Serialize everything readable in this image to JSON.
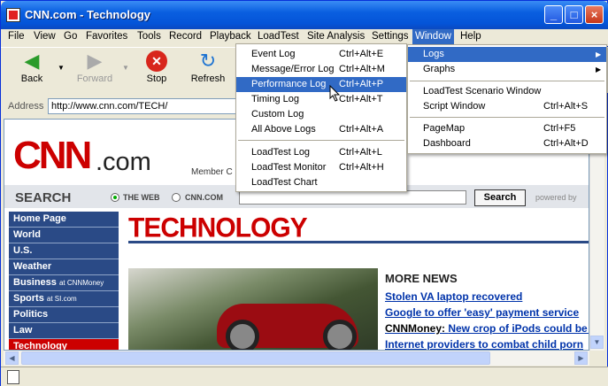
{
  "window": {
    "title": "CNN.com - Technology"
  },
  "menubar": [
    "File",
    "View",
    "Go",
    "Favorites",
    "Tools",
    "Record",
    "Playback",
    "LoadTest",
    "Site Analysis",
    "Settings",
    "Window",
    "Help"
  ],
  "toolbar": {
    "back": "Back",
    "forward": "Forward",
    "stop": "Stop",
    "refresh": "Refresh"
  },
  "address": {
    "label": "Address",
    "value": "http://www.cnn.com/TECH/"
  },
  "page": {
    "logo": "CNN",
    "logo_suffix": ".com",
    "member": "Member C",
    "search_label": "SEARCH",
    "radio_web": "THE WEB",
    "radio_cnn": "CNN.COM",
    "search_button": "Search",
    "powered_by": "powered by",
    "section_title": "TECHNOLOGY",
    "nav": [
      {
        "label": "Home Page",
        "sub": ""
      },
      {
        "label": "World",
        "sub": ""
      },
      {
        "label": "U.S.",
        "sub": ""
      },
      {
        "label": "Weather",
        "sub": ""
      },
      {
        "label": "Business",
        "sub": "at CNNMoney"
      },
      {
        "label": "Sports",
        "sub": "at SI.com"
      },
      {
        "label": "Politics",
        "sub": ""
      },
      {
        "label": "Law",
        "sub": ""
      },
      {
        "label": "Technology",
        "sub": ""
      }
    ],
    "more_news_title": "MORE NEWS",
    "news": [
      {
        "prefix": "",
        "text": "Stolen VA laptop recovered"
      },
      {
        "prefix": "",
        "text": "Google to offer 'easy' payment service"
      },
      {
        "prefix": "CNNMoney: ",
        "text": "New crop of iPods could be d"
      },
      {
        "prefix": "",
        "text": "Internet providers to combat child porn"
      }
    ]
  },
  "logs_menu": [
    {
      "label": "Event Log",
      "shortcut": "Ctrl+Alt+E"
    },
    {
      "label": "Message/Error Log",
      "shortcut": "Ctrl+Alt+M"
    },
    {
      "label": "Performance Log",
      "shortcut": "Ctrl+Alt+P"
    },
    {
      "label": "Timing Log",
      "shortcut": "Ctrl+Alt+T"
    },
    {
      "label": "Custom Log",
      "shortcut": ""
    },
    {
      "label": "All Above Logs",
      "shortcut": "Ctrl+Alt+A"
    },
    {
      "label": "LoadTest Log",
      "shortcut": "Ctrl+Alt+L"
    },
    {
      "label": "LoadTest Monitor",
      "shortcut": "Ctrl+Alt+H"
    },
    {
      "label": "LoadTest Chart",
      "shortcut": ""
    }
  ],
  "window_menu": [
    {
      "label": "Logs",
      "shortcut": ""
    },
    {
      "label": "Graphs",
      "shortcut": ""
    },
    {
      "label": "LoadTest Scenario Window",
      "shortcut": ""
    },
    {
      "label": "Script Window",
      "shortcut": "Ctrl+Alt+S"
    },
    {
      "label": "PageMap",
      "shortcut": "Ctrl+F5"
    },
    {
      "label": "Dashboard",
      "shortcut": "Ctrl+Alt+D"
    }
  ]
}
